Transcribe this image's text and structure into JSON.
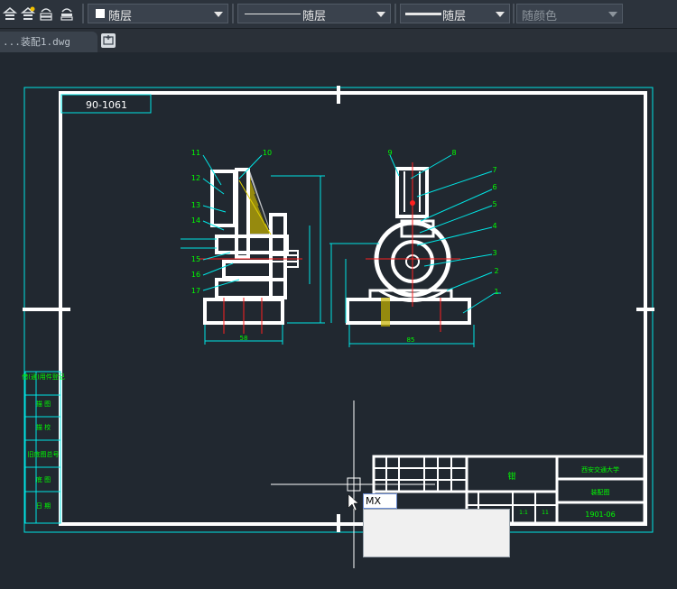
{
  "toolbar": {
    "layer_label": "随层",
    "linetype_label": "随层",
    "lineweight_label": "随层",
    "color_label": "随颜色"
  },
  "tabs": {
    "file_tab": "...装配1.dwg"
  },
  "drawing": {
    "title_code_top": "90-1061",
    "title_code_bottom": "1901-06",
    "product_name": "钳",
    "school": "西安交通大学",
    "drawing_type": "装配图",
    "scale_value": "1:1",
    "sheet_value": "11",
    "part_numbers": [
      "1",
      "2",
      "3",
      "4",
      "5",
      "6",
      "7",
      "8",
      "9",
      "10",
      "11",
      "12",
      "13",
      "14",
      "15",
      "16",
      "17"
    ],
    "dim_width_left": "58",
    "dim_width_right": "85",
    "left_side_labels": [
      "借(通)用件登记",
      "描 图",
      "描 校",
      "旧底图总号",
      "底 图",
      "日 期"
    ]
  },
  "command": {
    "input_text": "MX"
  },
  "colors": {
    "background": "#212830",
    "frame": "#ffffff",
    "cyan": "#00e5e5",
    "green": "#00ff00",
    "red": "#ff2020",
    "yellow": "#e0d000"
  }
}
